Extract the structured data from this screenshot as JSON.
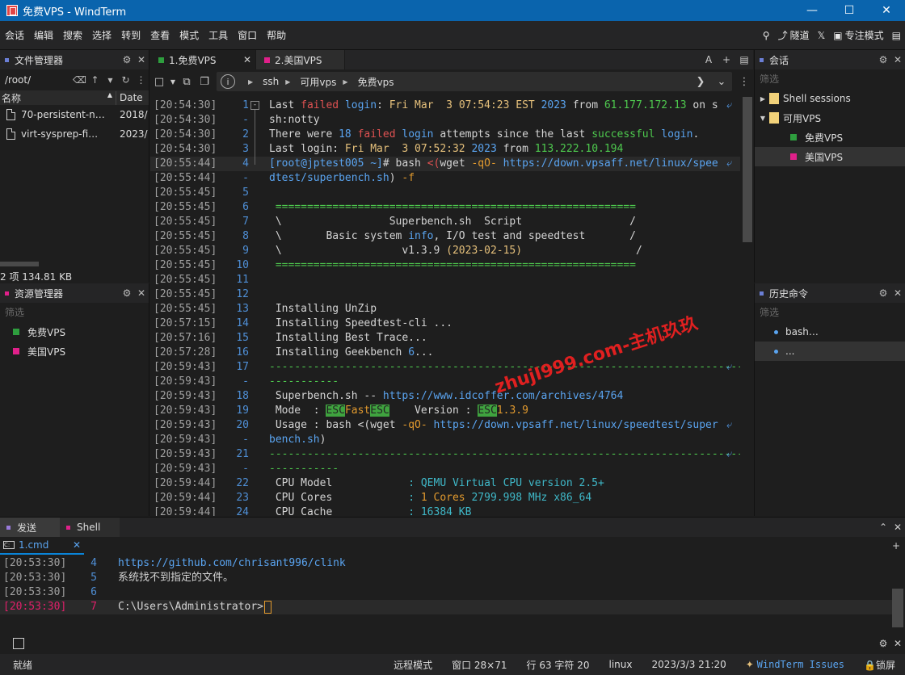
{
  "window": {
    "title": "免费VPS - WindTerm"
  },
  "menu": [
    "会话",
    "编辑",
    "搜索",
    "选择",
    "转到",
    "查看",
    "模式",
    "工具",
    "窗口",
    "帮助"
  ],
  "toolbar": {
    "tunnel": "隧道",
    "focus_mode": "专注模式"
  },
  "file_manager": {
    "title": "文件管理器",
    "path": "/root/",
    "col_name": "名称",
    "col_date": "Date",
    "files": [
      {
        "name": "70-persistent-n…",
        "date": "2018/"
      },
      {
        "name": "virt-sysprep-fi…",
        "date": "2023/"
      }
    ],
    "summary": "2 项 134.81 KB"
  },
  "resource_manager": {
    "title": "资源管理器",
    "filter": "筛选",
    "items": [
      {
        "label": "免费VPS",
        "color": "#2e9e3e"
      },
      {
        "label": "美国VPS",
        "color": "#e0208a"
      }
    ]
  },
  "tabs": [
    {
      "label": "1.免费VPS",
      "color": "#2e9e3e"
    },
    {
      "label": "2.美国VPS",
      "color": "#e0208a"
    }
  ],
  "breadcrumbs": [
    "ssh",
    "可用vps",
    "免费vps"
  ],
  "terminal": {
    "lines": [
      {
        "ts": "[20:54:30]",
        "ln": "1",
        "fold": "-",
        "wrap": true,
        "segs": [
          [
            "Last ",
            ""
          ],
          [
            "failed",
            "c-red"
          ],
          [
            " ",
            ""
          ],
          [
            "login",
            "c-blu"
          ],
          [
            ": ",
            ""
          ],
          [
            "Fri Mar  3 07:54:23 EST ",
            "c-yel"
          ],
          [
            "2023",
            "c-blu"
          ],
          [
            " from ",
            ""
          ],
          [
            "61.177.172.13",
            "c-grn"
          ],
          [
            " on s",
            ""
          ]
        ]
      },
      {
        "ts": "[20:54:30]",
        "ln": "-",
        "segs": [
          [
            "sh:notty",
            ""
          ]
        ]
      },
      {
        "ts": "[20:54:30]",
        "ln": "2",
        "segs": [
          [
            "There were ",
            ""
          ],
          [
            "18",
            "c-blu"
          ],
          [
            " ",
            ""
          ],
          [
            "failed",
            "c-red"
          ],
          [
            " ",
            ""
          ],
          [
            "login",
            "c-blu"
          ],
          [
            " attempts since the last ",
            ""
          ],
          [
            "successful",
            "c-grn"
          ],
          [
            " ",
            ""
          ],
          [
            "login",
            "c-blu"
          ],
          [
            ".",
            ""
          ]
        ]
      },
      {
        "ts": "[20:54:30]",
        "ln": "3",
        "segs": [
          [
            "Last login: ",
            ""
          ],
          [
            "Fri Mar  3 07:52:32 ",
            "c-yel"
          ],
          [
            "2023",
            "c-blu"
          ],
          [
            " from ",
            ""
          ],
          [
            "113.222.10.194",
            "c-grn"
          ]
        ]
      },
      {
        "ts": "[20:55:44]",
        "ln": "4",
        "wrap": true,
        "cur": true,
        "segs": [
          [
            "[root@jptest005 ~]",
            "c-blu"
          ],
          [
            "# bash ",
            ""
          ],
          [
            "<(",
            "c-red"
          ],
          [
            "wget ",
            ""
          ],
          [
            "-qO-",
            "c-org"
          ],
          [
            " https://down.vpsaff.net/linux/spee",
            "c-blu"
          ]
        ]
      },
      {
        "ts": "[20:55:44]",
        "ln": "-",
        "segs": [
          [
            "dtest/superbench.sh",
            "c-blu"
          ],
          [
            ") ",
            ""
          ],
          [
            "-f",
            "c-org"
          ]
        ]
      },
      {
        "ts": "[20:55:45]",
        "ln": "5",
        "segs": []
      },
      {
        "ts": "[20:55:45]",
        "ln": "6",
        "segs": [
          [
            " ",
            ""
          ],
          [
            "=========================================================",
            "c-grn"
          ]
        ]
      },
      {
        "ts": "[20:55:45]",
        "ln": "7",
        "segs": [
          [
            " \\                 Superbench.sh  Script                 /",
            ""
          ]
        ]
      },
      {
        "ts": "[20:55:45]",
        "ln": "8",
        "segs": [
          [
            " \\       Basic system ",
            ""
          ],
          [
            "info",
            "c-blu"
          ],
          [
            ", I/O test and speedtest       /",
            ""
          ]
        ]
      },
      {
        "ts": "[20:55:45]",
        "ln": "9",
        "segs": [
          [
            " \\                   v1.3.9 ",
            ""
          ],
          [
            "(2023-02-15)",
            "c-yel"
          ],
          [
            "                  /",
            ""
          ]
        ]
      },
      {
        "ts": "[20:55:45]",
        "ln": "10",
        "segs": [
          [
            " ",
            ""
          ],
          [
            "=========================================================",
            "c-grn"
          ]
        ]
      },
      {
        "ts": "[20:55:45]",
        "ln": "11",
        "segs": []
      },
      {
        "ts": "[20:55:45]",
        "ln": "12",
        "segs": []
      },
      {
        "ts": "[20:55:45]",
        "ln": "13",
        "segs": [
          [
            " Installing UnZip",
            ""
          ]
        ]
      },
      {
        "ts": "[20:57:15]",
        "ln": "14",
        "segs": [
          [
            " Installing Speedtest-cli ...",
            ""
          ]
        ]
      },
      {
        "ts": "[20:57:16]",
        "ln": "15",
        "segs": [
          [
            " Installing Best Trace...",
            ""
          ]
        ]
      },
      {
        "ts": "[20:57:28]",
        "ln": "16",
        "segs": [
          [
            " Installing Geekbench ",
            ""
          ],
          [
            "6",
            "c-blu"
          ],
          [
            "...",
            ""
          ]
        ]
      },
      {
        "ts": "[20:59:43]",
        "ln": "17",
        "wrap": true,
        "segs": [
          [
            "---------------------------------------------------------------------------",
            "c-grn"
          ]
        ]
      },
      {
        "ts": "[20:59:43]",
        "ln": "-",
        "segs": [
          [
            "-----------",
            "c-grn"
          ]
        ]
      },
      {
        "ts": "[20:59:43]",
        "ln": "18",
        "segs": [
          [
            " Superbench.sh -- ",
            ""
          ],
          [
            "https://www.idcoffer.com/archives/4764",
            "c-blu"
          ]
        ]
      },
      {
        "ts": "[20:59:43]",
        "ln": "19",
        "segs": [
          [
            " Mode  : ",
            ""
          ],
          [
            "ESC",
            "c-esc"
          ],
          [
            "Fast",
            "c-org"
          ],
          [
            "ESC",
            "c-esc"
          ],
          [
            "    Version : ",
            ""
          ],
          [
            "ESC",
            "c-esc"
          ],
          [
            "1.3.9",
            "c-org"
          ]
        ]
      },
      {
        "ts": "[20:59:43]",
        "ln": "20",
        "wrap": true,
        "segs": [
          [
            " Usage : bash <(wget ",
            ""
          ],
          [
            "-qO-",
            "c-org"
          ],
          [
            " https://down.vpsaff.net/linux/speedtest/super",
            "c-blu"
          ]
        ]
      },
      {
        "ts": "[20:59:43]",
        "ln": "-",
        "segs": [
          [
            "bench.sh",
            "c-blu"
          ],
          [
            ")",
            ""
          ]
        ]
      },
      {
        "ts": "[20:59:43]",
        "ln": "21",
        "wrap": true,
        "segs": [
          [
            "---------------------------------------------------------------------------",
            "c-grn"
          ]
        ]
      },
      {
        "ts": "[20:59:43]",
        "ln": "-",
        "segs": [
          [
            "-----------",
            "c-grn"
          ]
        ]
      },
      {
        "ts": "[20:59:44]",
        "ln": "22",
        "segs": [
          [
            " CPU Model            ",
            ""
          ],
          [
            ": QEMU Virtual CPU version 2.5+",
            "c-cyan"
          ]
        ]
      },
      {
        "ts": "[20:59:44]",
        "ln": "23",
        "segs": [
          [
            " CPU Cores            ",
            ""
          ],
          [
            ": ",
            "c-cyan"
          ],
          [
            "1 Cores",
            "c-org"
          ],
          [
            " 2799.998 MHz x86_64",
            "c-cyan"
          ]
        ]
      },
      {
        "ts": "[20:59:44]",
        "ln": "24",
        "segs": [
          [
            " CPU Cache            ",
            ""
          ],
          [
            ": 16384 KB",
            "c-cyan"
          ]
        ]
      }
    ]
  },
  "watermark": "zhujI999.com-主机玖玖",
  "sessions": {
    "title": "会话",
    "filter": "筛选",
    "items": [
      {
        "label": "Shell sessions",
        "arrow": "▶",
        "kind": "folder",
        "level": 0
      },
      {
        "label": "可用VPS",
        "arrow": "▼",
        "kind": "folder",
        "level": 0
      },
      {
        "label": "免费VPS",
        "kind": "item",
        "color": "#2e9e3e",
        "level": 1
      },
      {
        "label": "美国VPS",
        "kind": "item",
        "color": "#e0208a",
        "level": 1,
        "selected": true
      }
    ]
  },
  "history": {
    "title": "历史命令",
    "filter": "筛选",
    "items": [
      {
        "label": "bash…"
      },
      {
        "label": "...",
        "selected": true
      }
    ]
  },
  "bottom": {
    "tabs": [
      {
        "label": "发送",
        "color": "#9a7bdc"
      },
      {
        "label": "Shell",
        "color": "#e0208a"
      }
    ],
    "subtab": "1.cmd",
    "lines": [
      {
        "ts": "[20:53:30]",
        "ln": "4",
        "text": "https://github.com/chrisant996/clink",
        "cls": "c-blu"
      },
      {
        "ts": "[20:53:30]",
        "ln": "5",
        "text": "系统找不到指定的文件。",
        "cls": ""
      },
      {
        "ts": "[20:53:30]",
        "ln": "6",
        "text": "",
        "cls": ""
      },
      {
        "ts": "[20:53:30]",
        "ln": "7",
        "text": "C:\\Users\\Administrator>",
        "cls": "",
        "cur": true
      }
    ]
  },
  "status": {
    "ready": "就绪",
    "mode": "远程模式",
    "window_size": "窗口 28×71",
    "position": "行 63 字符 20",
    "os": "linux",
    "datetime": "2023/3/3 21:20",
    "issues": "WindTerm Issues",
    "lock": "锁屏"
  }
}
